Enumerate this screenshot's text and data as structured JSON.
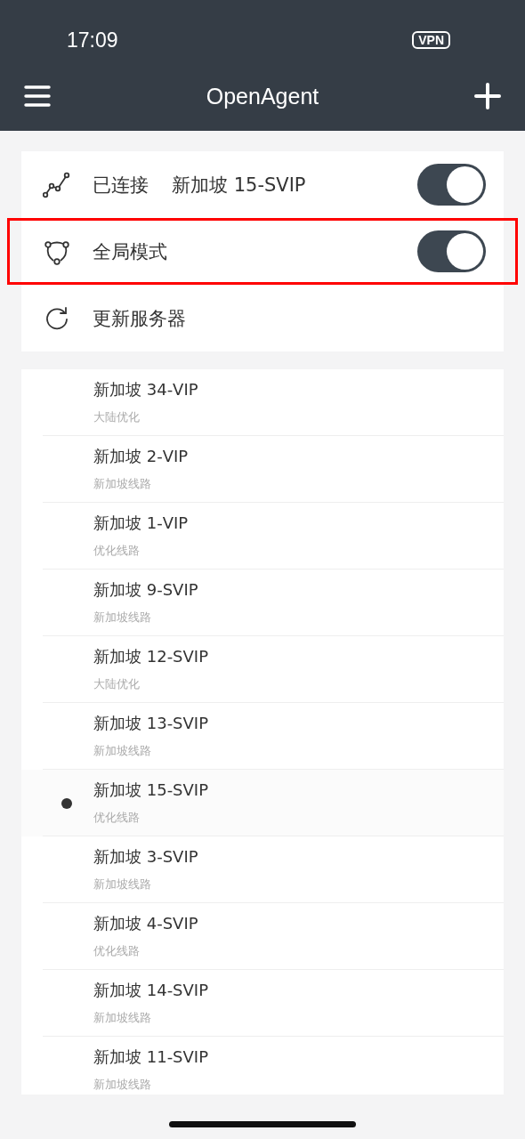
{
  "status_bar": {
    "time": "17:09",
    "vpn_badge": "VPN"
  },
  "nav_bar": {
    "title": "OpenAgent"
  },
  "settings": [
    {
      "kind": "toggle",
      "label": "已连接",
      "value": "新加坡 15-SVIP",
      "on": true,
      "highlighted": false
    },
    {
      "kind": "toggle",
      "label": "全局模式",
      "on": true,
      "highlighted": true
    },
    {
      "kind": "action",
      "label": "更新服务器",
      "highlighted": false
    }
  ],
  "servers": [
    {
      "name": "新加坡 34-VIP",
      "route": "大陆优化",
      "selected": false
    },
    {
      "name": "新加坡 2-VIP",
      "route": "新加坡线路",
      "selected": false
    },
    {
      "name": "新加坡 1-VIP",
      "route": "优化线路",
      "selected": false
    },
    {
      "name": "新加坡 9-SVIP",
      "route": "新加坡线路",
      "selected": false
    },
    {
      "name": "新加坡 12-SVIP",
      "route": "大陆优化",
      "selected": false
    },
    {
      "name": "新加坡 13-SVIP",
      "route": "新加坡线路",
      "selected": false
    },
    {
      "name": "新加坡 15-SVIP",
      "route": "优化线路",
      "selected": true
    },
    {
      "name": "新加坡 3-SVIP",
      "route": "新加坡线路",
      "selected": false
    },
    {
      "name": "新加坡 4-SVIP",
      "route": "优化线路",
      "selected": false
    },
    {
      "name": "新加坡 14-SVIP",
      "route": "新加坡线路",
      "selected": false
    },
    {
      "name": "新加坡 11-SVIP",
      "route": "新加坡线路",
      "selected": false
    }
  ]
}
